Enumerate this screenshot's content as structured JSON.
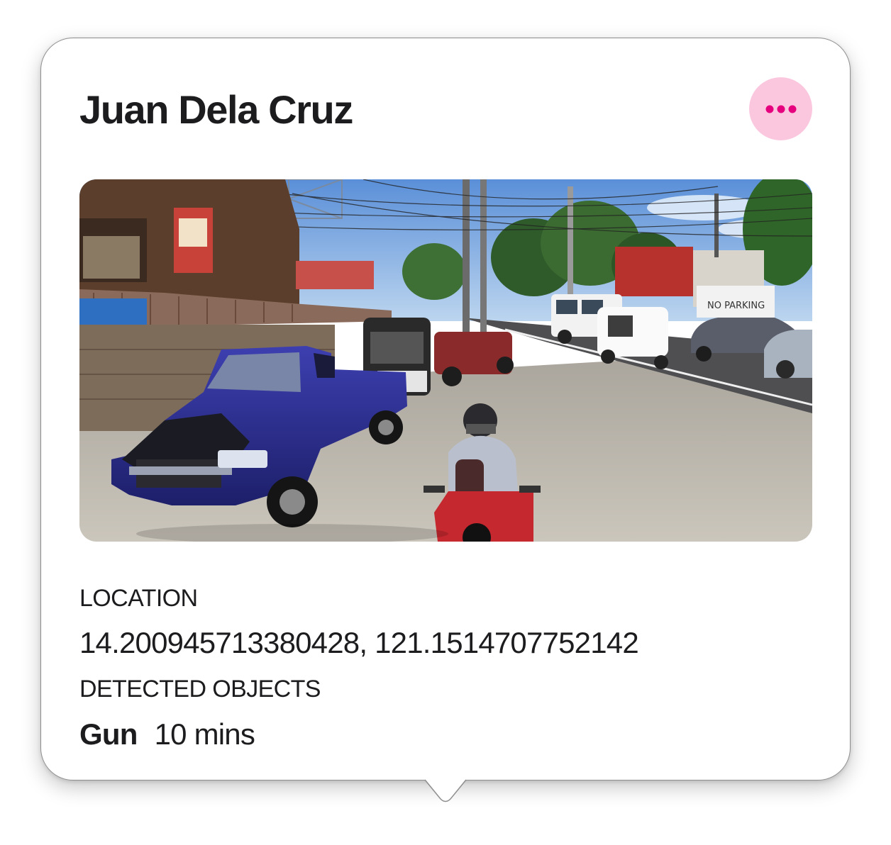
{
  "card": {
    "title": "Juan Dela Cruz",
    "more_button_icon": "ellipsis-icon",
    "image": {
      "subject": "street-scene-photo",
      "description_icon": "photo"
    },
    "location_label": "LOCATION",
    "location_value": "14.200945713380428, 121.1514707752142",
    "detected_label": "DETECTED OBJECTS",
    "detected_object": "Gun",
    "detected_time": "10 mins"
  },
  "colors": {
    "accent": "#e6007e",
    "accent_bg": "#fbc7df",
    "text": "#1c1c1e",
    "border": "#8e8e8e"
  }
}
